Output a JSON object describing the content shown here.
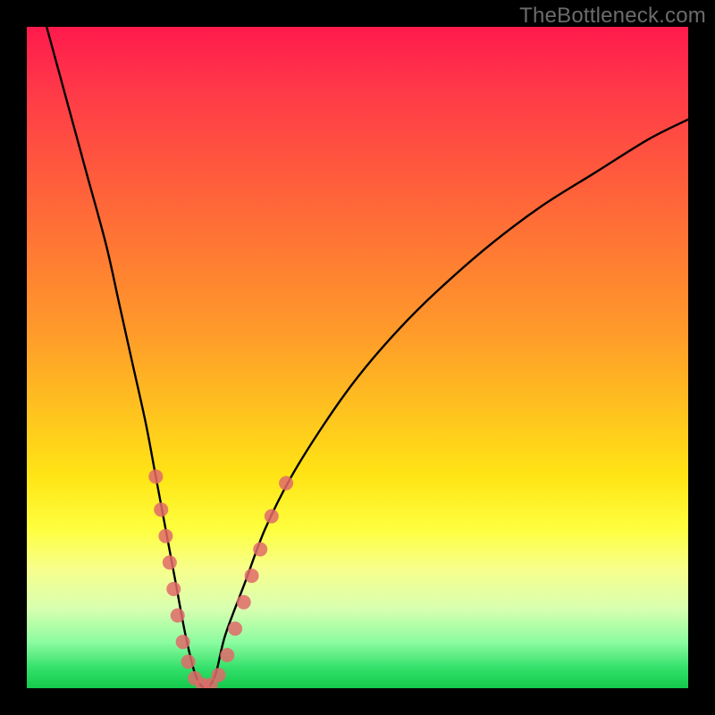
{
  "watermark": {
    "text": "TheBottleneck.com"
  },
  "chart_data": {
    "type": "line",
    "title": "",
    "xlabel": "",
    "ylabel": "",
    "xlim": [
      0,
      100
    ],
    "ylim": [
      0,
      100
    ],
    "grid": false,
    "legend": false,
    "background_gradient": {
      "direction": "vertical",
      "stops": [
        {
          "pos": 0.0,
          "color": "#ff1a4d"
        },
        {
          "pos": 0.22,
          "color": "#ff5a3d"
        },
        {
          "pos": 0.46,
          "color": "#ff9a2a"
        },
        {
          "pos": 0.68,
          "color": "#ffe515"
        },
        {
          "pos": 0.82,
          "color": "#f7ff8c"
        },
        {
          "pos": 0.93,
          "color": "#8dfca0"
        },
        {
          "pos": 1.0,
          "color": "#14c94b"
        }
      ]
    },
    "series": [
      {
        "name": "bottleneck-curve",
        "x": [
          3,
          6,
          9,
          12,
          14,
          16,
          18,
          19.5,
          21,
          22.5,
          24,
          25.5,
          27,
          28.5,
          30,
          33,
          36,
          40,
          45,
          50,
          56,
          62,
          70,
          78,
          86,
          94,
          100
        ],
        "y": [
          100,
          89,
          78,
          67,
          58,
          49,
          40,
          32,
          24,
          16,
          8,
          2,
          0,
          2,
          8,
          16,
          24,
          32,
          40,
          47,
          54,
          60,
          67,
          73,
          78,
          83,
          86
        ]
      }
    ],
    "markers": {
      "name": "sample-points",
      "color": "#e06a6a",
      "radius_px": 8,
      "points": [
        {
          "x": 19.5,
          "y": 32
        },
        {
          "x": 20.3,
          "y": 27
        },
        {
          "x": 21.0,
          "y": 23
        },
        {
          "x": 21.6,
          "y": 19
        },
        {
          "x": 22.2,
          "y": 15
        },
        {
          "x": 22.8,
          "y": 11
        },
        {
          "x": 23.6,
          "y": 7
        },
        {
          "x": 24.4,
          "y": 4
        },
        {
          "x": 25.4,
          "y": 1.5
        },
        {
          "x": 26.6,
          "y": 0.5
        },
        {
          "x": 27.8,
          "y": 0.5
        },
        {
          "x": 29.0,
          "y": 2
        },
        {
          "x": 30.3,
          "y": 5
        },
        {
          "x": 31.5,
          "y": 9
        },
        {
          "x": 32.8,
          "y": 13
        },
        {
          "x": 34.0,
          "y": 17
        },
        {
          "x": 35.3,
          "y": 21
        },
        {
          "x": 37.0,
          "y": 26
        },
        {
          "x": 39.2,
          "y": 31
        }
      ]
    },
    "note": "Values are estimated from pixel positions; chart has no visible axis ticks or labels. y=0 is the bottom (green) edge; y=100 is the top (red) edge. The curve minimum (zero bottleneck) is near x≈27."
  }
}
